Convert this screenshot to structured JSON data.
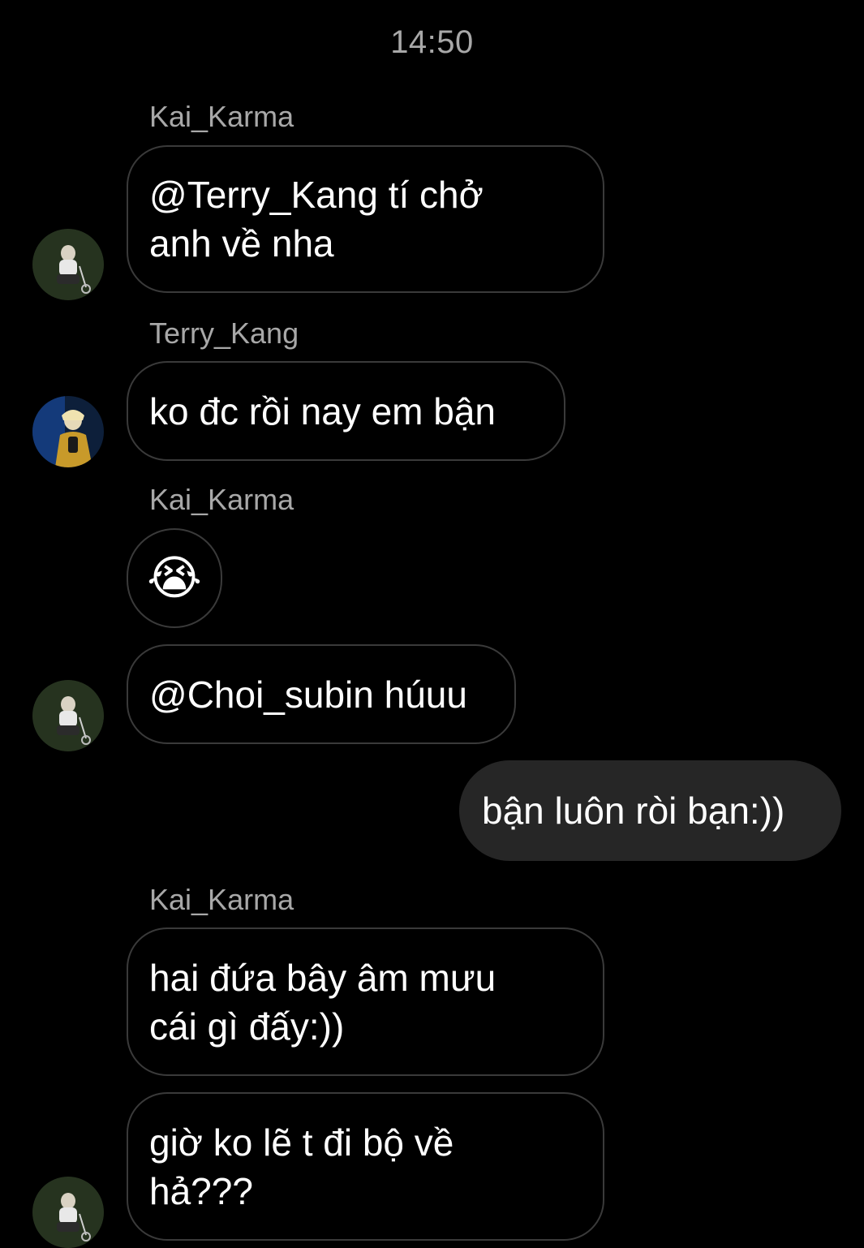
{
  "chat": {
    "timestamp": "14:50",
    "messages": [
      {
        "sender": "Kai_Karma",
        "text": "@Terry_Kang tí chở anh về nha"
      },
      {
        "sender": "Terry_Kang",
        "text": "ko đc rồi nay em bận"
      },
      {
        "sender": "Kai_Karma",
        "text": "😭"
      },
      {
        "sender": "Kai_Karma",
        "text": "@Choi_subin húuu"
      },
      {
        "sender": "",
        "text": "bận luôn ròi bạn:))"
      },
      {
        "sender": "Kai_Karma",
        "text": "hai đứa bây âm mưu cái gì đấy:))"
      },
      {
        "sender": "Kai_Karma",
        "text": "giờ ko lẽ t đi bộ về hả???"
      }
    ]
  },
  "colors": {
    "background": "#000000",
    "bubble_border": "#3a3a3a",
    "outgoing_bubble": "#262626",
    "meta_text": "#a8a8a8",
    "message_text": "#ffffff"
  },
  "icons": {
    "kai_avatar": "kai-karma-avatar-icon",
    "terry_avatar": "terry-kang-avatar-icon"
  }
}
